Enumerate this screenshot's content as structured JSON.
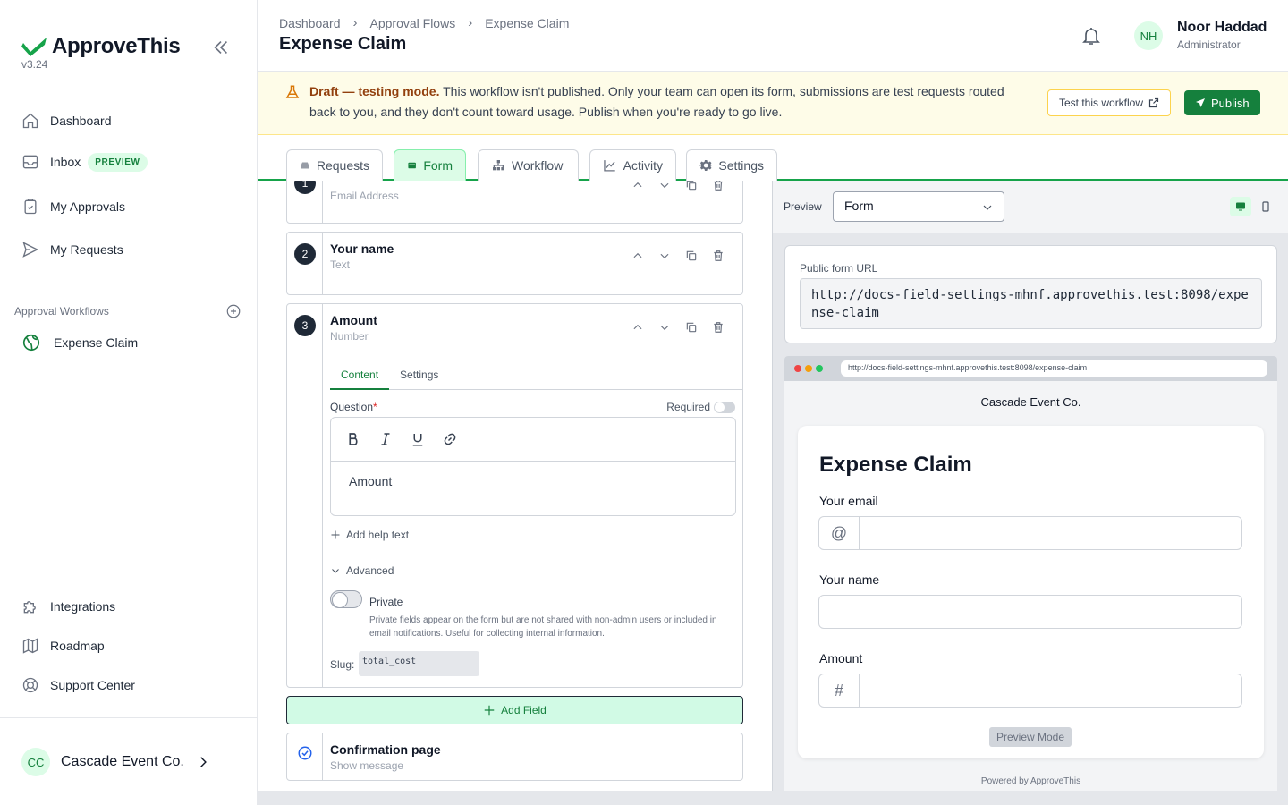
{
  "brand": {
    "name": "ApproveThis",
    "version": "v3.24"
  },
  "sidebar": {
    "items": [
      {
        "label": "Dashboard"
      },
      {
        "label": "Inbox",
        "badge": "PREVIEW"
      },
      {
        "label": "My Approvals"
      },
      {
        "label": "My Requests"
      }
    ],
    "workflows_label": "Approval Workflows",
    "workflows": [
      {
        "label": "Expense Claim"
      }
    ],
    "bottom_items": [
      {
        "label": "Integrations"
      },
      {
        "label": "Roadmap"
      },
      {
        "label": "Support Center"
      }
    ],
    "org": {
      "initials": "CC",
      "name": "Cascade Event Co."
    }
  },
  "header": {
    "breadcrumb": [
      "Dashboard",
      "Approval Flows",
      "Expense Claim"
    ],
    "title": "Expense Claim",
    "user": {
      "initials": "NH",
      "name": "Noor Haddad",
      "role": "Administrator"
    }
  },
  "banner": {
    "strong": "Draft — testing mode.",
    "text": " This workflow isn't published. Only your team can open its form, submissions are test requests routed back to you, and they don't count toward usage. Publish when you're ready to go live.",
    "test_label": "Test this workflow",
    "publish_label": "Publish"
  },
  "tabs": [
    {
      "label": "Requests"
    },
    {
      "label": "Form",
      "active": true
    },
    {
      "label": "Workflow"
    },
    {
      "label": "Activity"
    },
    {
      "label": "Settings"
    }
  ],
  "fields": [
    {
      "num": "1",
      "title": "",
      "type": "Email Address"
    },
    {
      "num": "2",
      "title": "Your name",
      "type": "Text"
    },
    {
      "num": "3",
      "title": "Amount",
      "type": "Number",
      "subtabs": [
        "Content",
        "Settings"
      ],
      "question_label": "Question",
      "required_label": "Required",
      "question_text": "Amount",
      "add_help": "Add help text",
      "advanced": "Advanced",
      "private_label": "Private",
      "private_desc": "Private fields appear on the form but are not shared with non-admin users or included in email notifications. Useful for collecting internal information.",
      "slug_label": "Slug:",
      "slug": "total_cost"
    }
  ],
  "add_field_label": "Add Field",
  "confirmation": {
    "title": "Confirmation page",
    "subtitle": "Show message"
  },
  "preview": {
    "label": "Preview",
    "select_value": "Form",
    "url_label": "Public form URL",
    "url": "http://docs-field-settings-mhnf.approvethis.test:8098/expense-claim",
    "org_title": "Cascade Event Co.",
    "form_title": "Expense Claim",
    "form_fields": [
      {
        "label": "Your email",
        "addon": "@"
      },
      {
        "label": "Your name",
        "addon": ""
      },
      {
        "label": "Amount",
        "addon": "#"
      }
    ],
    "preview_mode_label": "Preview Mode",
    "powered_by": "Powered by ApproveThis"
  },
  "colors": {
    "accent": "#15803d",
    "accent_light": "#dcfce7",
    "banner_bg": "#fefce8"
  }
}
